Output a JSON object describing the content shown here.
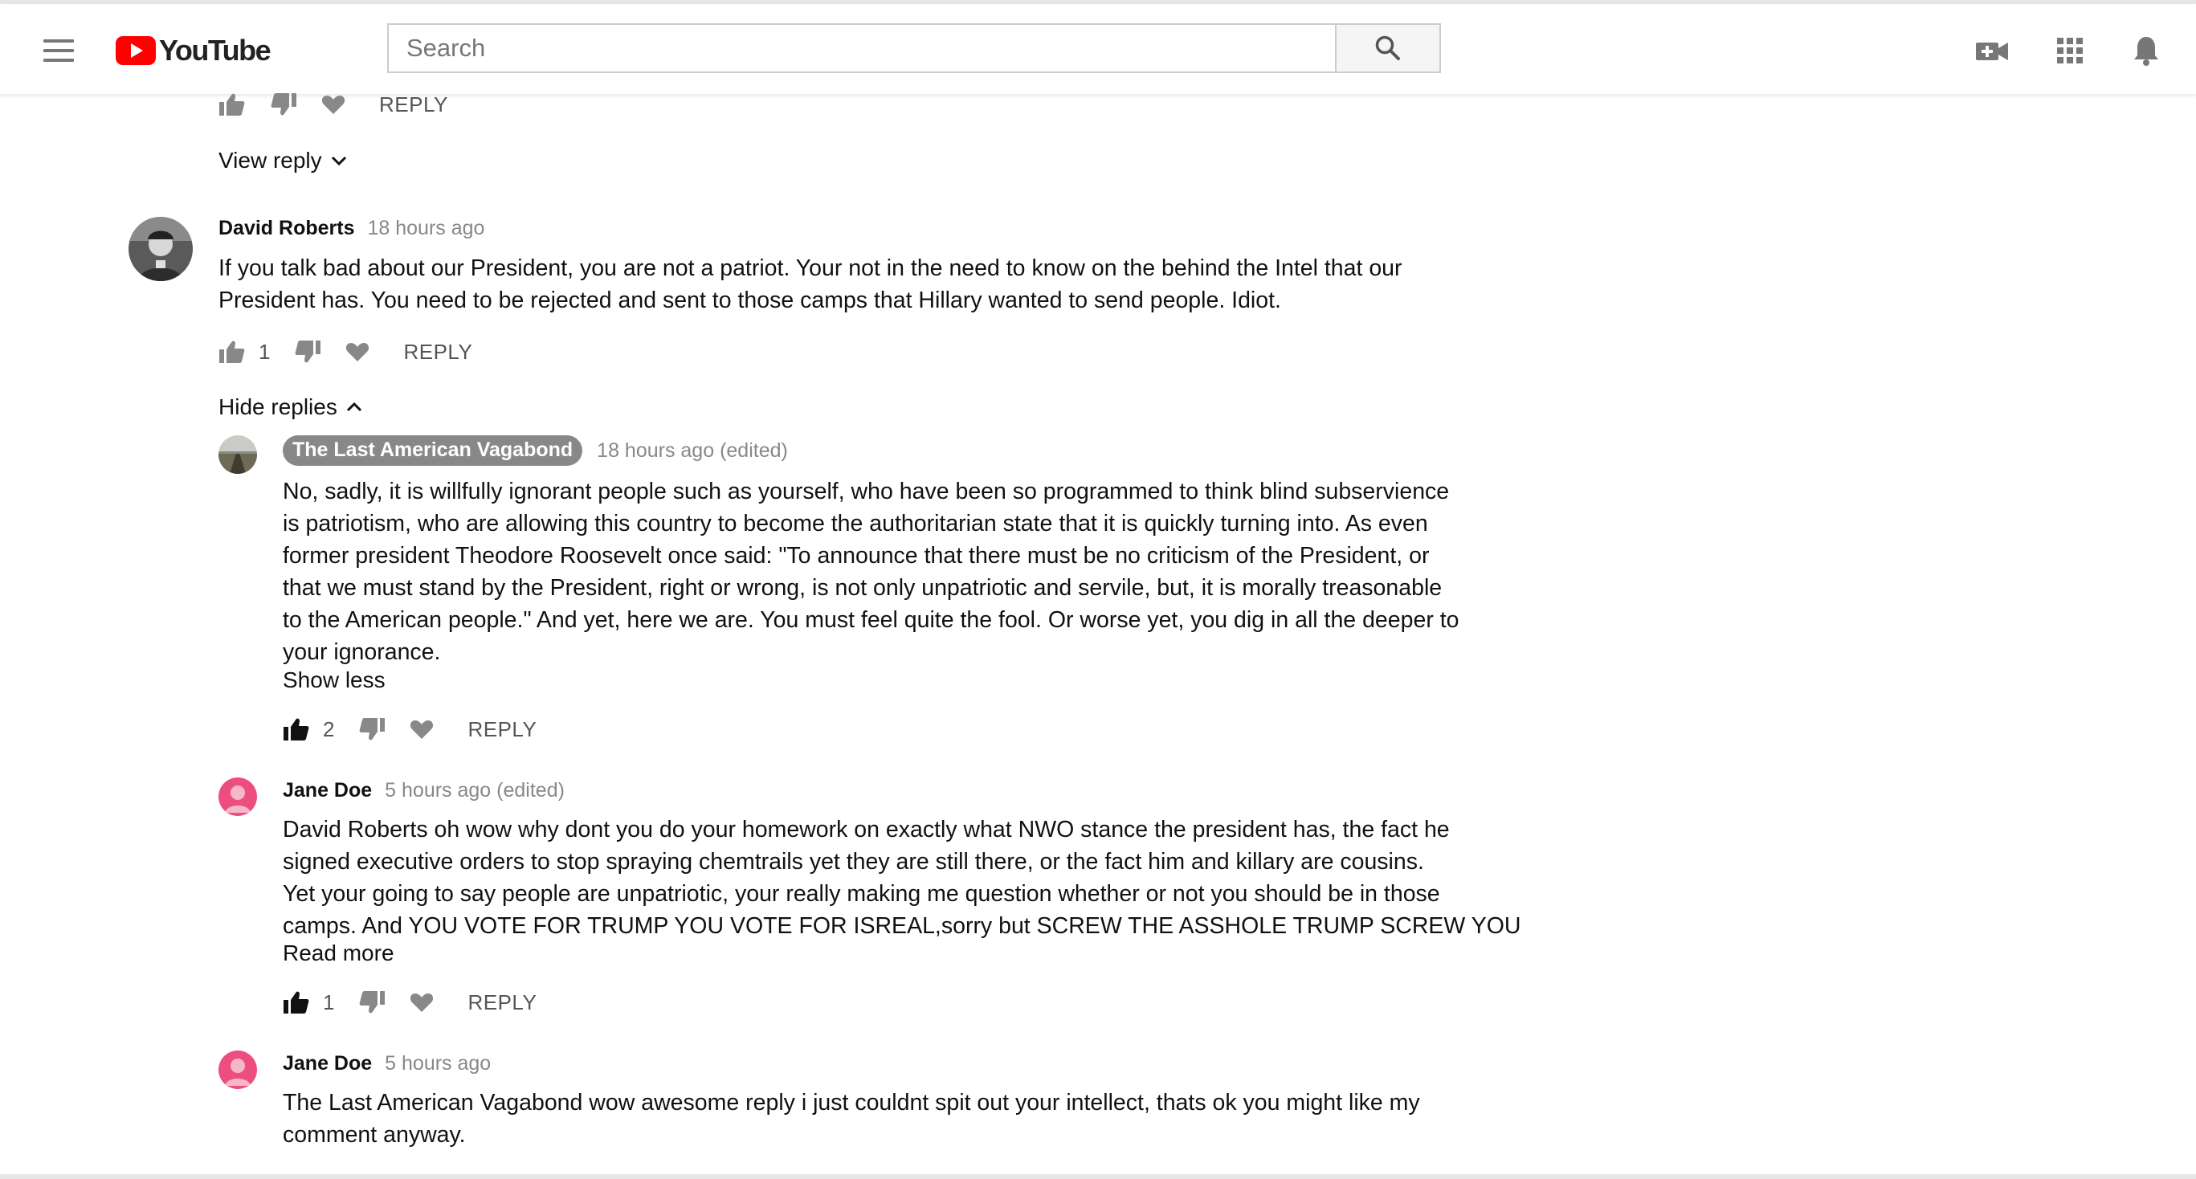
{
  "header": {
    "logo_text": "YouTube",
    "search_placeholder": "Search",
    "icons": [
      "menu-icon",
      "search-icon",
      "video-camera-add-icon",
      "apps-grid-icon",
      "notification-bell-icon"
    ],
    "brand_color": "#ff0000"
  },
  "top_actions": {
    "reply_label": "REPLY"
  },
  "view_reply": {
    "label": "View reply"
  },
  "comment": {
    "author": "David Roberts",
    "time": "18 hours ago",
    "text_line1": "If you talk bad about our President,  you are not a patriot. Your not in the need to know on the behind the  Intel that our",
    "text_line2": "President has. You need to be rejected and sent to those camps that Hillary wanted to send people. Idiot.",
    "likes": "1",
    "reply_label": "REPLY"
  },
  "hide_replies": {
    "label": "Hide replies"
  },
  "replies": [
    {
      "author": "The Last American Vagabond",
      "time": "18 hours ago (edited)",
      "lines": [
        "No, sadly, it is willfully ignorant people such as yourself, who have been so programmed to think blind subservience",
        "is patriotism, who are allowing this country to become the authoritarian state that it is quickly turning into. As even",
        "former president Theodore Roosevelt once said:  \"To announce that there must be no criticism of the President, or",
        "that we must stand by the President, right or wrong, is not only unpatriotic and servile, but, it is morally treasonable",
        "to the American people.\" And yet, here we are. You must feel quite the fool. Or worse yet, you dig in all the deeper to",
        "your ignorance."
      ],
      "toggle_label": "Show less",
      "likes": "2",
      "reply_label": "REPLY"
    },
    {
      "author": "Jane Doe",
      "time": "5 hours ago (edited)",
      "lines": [
        "David Roberts oh wow why dont you do your homework on exactly what NWO stance the president has, the fact he",
        "signed executive orders to stop spraying chemtrails yet they are still there, or the fact him and killary are cousins.",
        "Yet your going to say people are unpatriotic, your really making me question whether or not you should be in those",
        "camps. And YOU VOTE FOR TRUMP YOU VOTE FOR ISREAL,sorry but SCREW THE ASSHOLE TRUMP SCREW YOU"
      ],
      "toggle_label": "Read more",
      "likes": "1",
      "reply_label": "REPLY"
    },
    {
      "author": "Jane Doe",
      "time": "5 hours ago",
      "lines": [
        "The Last American Vagabond wow awesome reply i just couldnt spit out your intellect, thats ok you might like my",
        "comment anyway."
      ]
    }
  ]
}
